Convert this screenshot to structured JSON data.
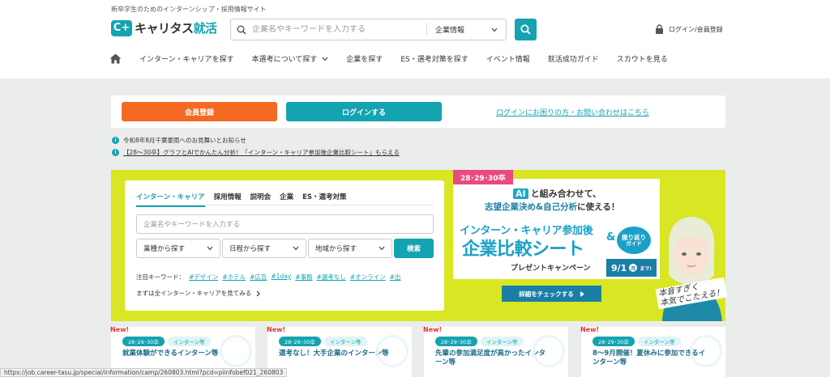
{
  "header": {
    "tagline": "新卒学生のためのインターンシップ・採用情報サイト",
    "logo_mark": "C+",
    "logo_name_main": "キャリタス",
    "logo_name_accent": "就活",
    "search_placeholder": "企業名やキーワードを入力する",
    "search_category": "企業情報",
    "login_label": "ログイン/会員登録"
  },
  "nav": {
    "items": [
      "インターン・キャリアを探す",
      "本選考について探す",
      "企業を探す",
      "ES・選考対策を探す",
      "イベント情報",
      "就活成功ガイド",
      "スカウトを見る"
    ]
  },
  "auth": {
    "register": "会員登録",
    "login": "ログインする",
    "help": "ログインにお困りの方・お問い合わせはこちら"
  },
  "notices": [
    "令和8年8月千葉豪雨へのお見舞いとお知らせ",
    "【28〜30卒】グラフとAIでかんたん分析！「インターン・キャリア参加後企業比較シート」もらえる"
  ],
  "search_panel": {
    "tabs": [
      "インターン・キャリア",
      "採用情報",
      "説明会",
      "企業",
      "ES・選考対策"
    ],
    "keyword_placeholder": "企業名やキーワードを入力する",
    "selects": [
      "業種から探す",
      "日程から探す",
      "地域から探す"
    ],
    "search_button": "検索",
    "keywords_label": "注目キーワード：",
    "keywords": [
      "#デザイン",
      "#ホテル",
      "#広告",
      "#1day",
      "#事務",
      "#選考なし",
      "#オンライン",
      "#出"
    ],
    "view_all": "まずは全インターン・キャリアを見てみる"
  },
  "banner": {
    "year": "28･29･30卒",
    "ai": "AI",
    "line1": "と組み合わせて、",
    "line2a": "志望企業決め",
    "line2b": "&",
    "line2c": "自己分析",
    "line2d": "に使える！",
    "line3": "インターン・キャリア参加後",
    "line4": "企業比較シート",
    "amp": "&",
    "badge_top": "振り返り",
    "badge_bottom": "ガイド",
    "line5": "プレゼントキャンペーン",
    "date": "9/1",
    "weekday": "月",
    "until": "まで!",
    "button": "詳細をチェックする",
    "handwriting_1": "本音すぎく",
    "handwriting_2": "本気でこたえる！"
  },
  "cards": [
    {
      "new": "New!",
      "year": "28･29･30卒",
      "type": "インターン等",
      "title": "就業体験ができるインターン等"
    },
    {
      "new": "New!",
      "year": "28･29･30卒",
      "type": "インターン等",
      "title": "選考なし！大手企業のインターン等"
    },
    {
      "new": "New!",
      "year": "28･29･30卒",
      "type": "インターン等",
      "title": "先輩の参加満足度が高かったインターン等"
    },
    {
      "new": "New!",
      "year": "28･29･30卒",
      "type": "インターン等",
      "title": "8〜9月開催！夏休みに参加できるインターン等"
    }
  ],
  "status_url": "https://job.career-tasu.jp/special/information/camp/260803.html?pcd=piinfobef021_260803",
  "colors": {
    "teal": "#14a3b0",
    "orange": "#f46a22",
    "lime": "#d8e623",
    "pink": "#e94b7e"
  }
}
